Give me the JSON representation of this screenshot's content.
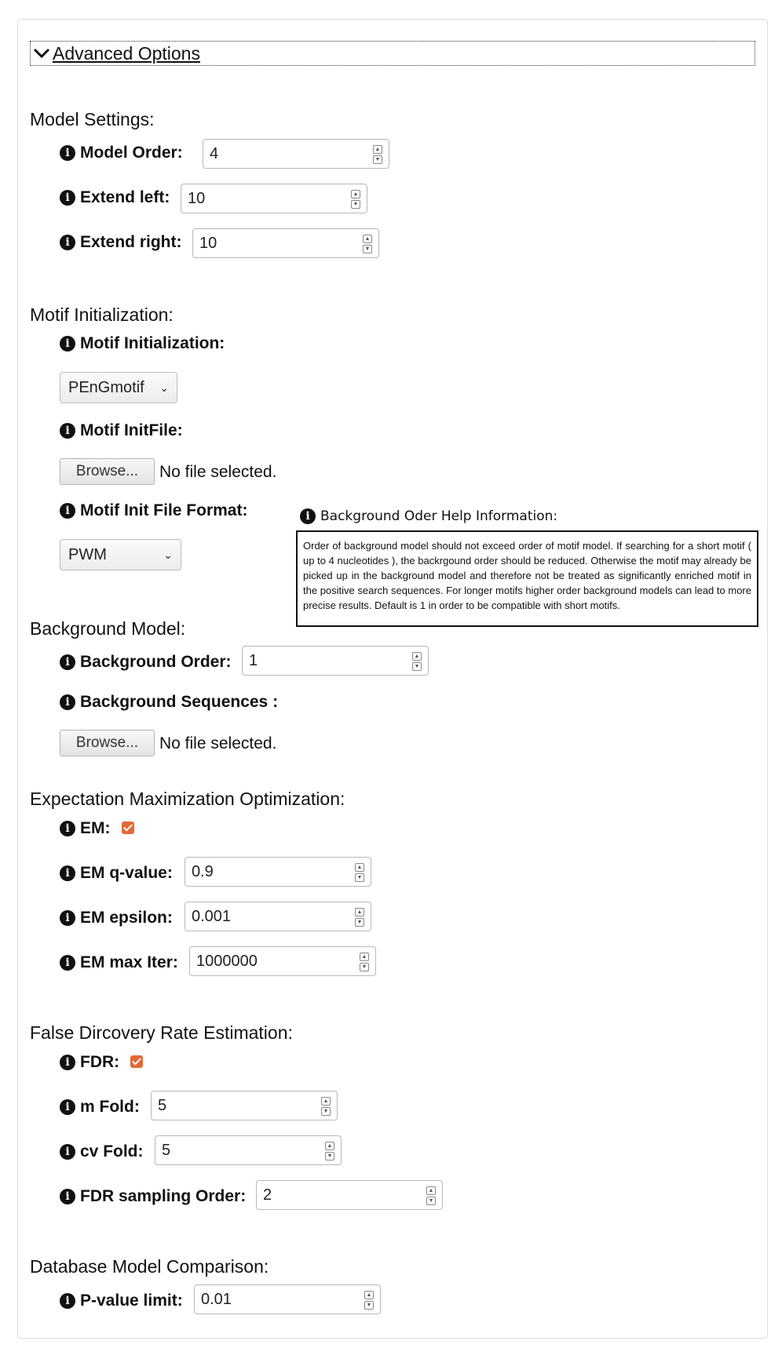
{
  "advanced": {
    "label": "Advanced Options"
  },
  "sections": {
    "model_settings": "Model Settings:",
    "motif_init": "Motif Initialization:",
    "background_model": "Background Model:",
    "em_opt": "Expectation Maximization Optimization:",
    "fdr_est": "False Dircovery Rate Estimation:",
    "db_compare": "Database Model Comparison:"
  },
  "model_order": {
    "label": "Model Order:",
    "value": "4"
  },
  "extend_left": {
    "label": "Extend left:",
    "value": "10"
  },
  "extend_right": {
    "label": "Extend right:",
    "value": "10"
  },
  "motif_init_field": {
    "label": "Motif Initialization:",
    "selected": "PEnGmotif"
  },
  "motif_init_file": {
    "label": "Motif InitFile:",
    "button": "Browse...",
    "status": "No file selected."
  },
  "motif_init_format": {
    "label": "Motif Init File Format:",
    "selected": "PWM"
  },
  "help": {
    "title": "Background Oder Help Information:",
    "text": "Order of background model should not exceed order of motif model. If searching for a short motif ( up to 4 nucleotides ), the backrgound order should be reduced. Otherwise the motif may already be picked up in the background model and therefore not be treated as significantly enriched motif in the positive search sequences. For longer motifs higher order background models can lead to more precise results. Default is 1 in order to be compatible with short motifs."
  },
  "background_order": {
    "label": "Background Order:",
    "value": "1"
  },
  "background_sequences": {
    "label": "Background Sequences :",
    "button": "Browse...",
    "status": "No file selected."
  },
  "em": {
    "label": "EM:",
    "checked": true
  },
  "em_qvalue": {
    "label": "EM q-value:",
    "value": "0.9"
  },
  "em_epsilon": {
    "label": "EM epsilon:",
    "value": "0.001"
  },
  "em_maxiter": {
    "label": "EM max Iter:",
    "value": "1000000"
  },
  "fdr": {
    "label": "FDR:",
    "checked": true
  },
  "m_fold": {
    "label": "m Fold:",
    "value": "5"
  },
  "cv_fold": {
    "label": "cv Fold:",
    "value": "5"
  },
  "fdr_sampling_order": {
    "label": "FDR sampling Order:",
    "value": "2"
  },
  "pvalue_limit": {
    "label": "P-value limit:",
    "value": "0.01"
  },
  "colors": {
    "checkbox": "#e06a36",
    "border": "#b8b8b8"
  },
  "icons": {
    "info": "info-icon",
    "chevron": "chevron-down-icon",
    "spin": "spinner-arrows-icon"
  }
}
